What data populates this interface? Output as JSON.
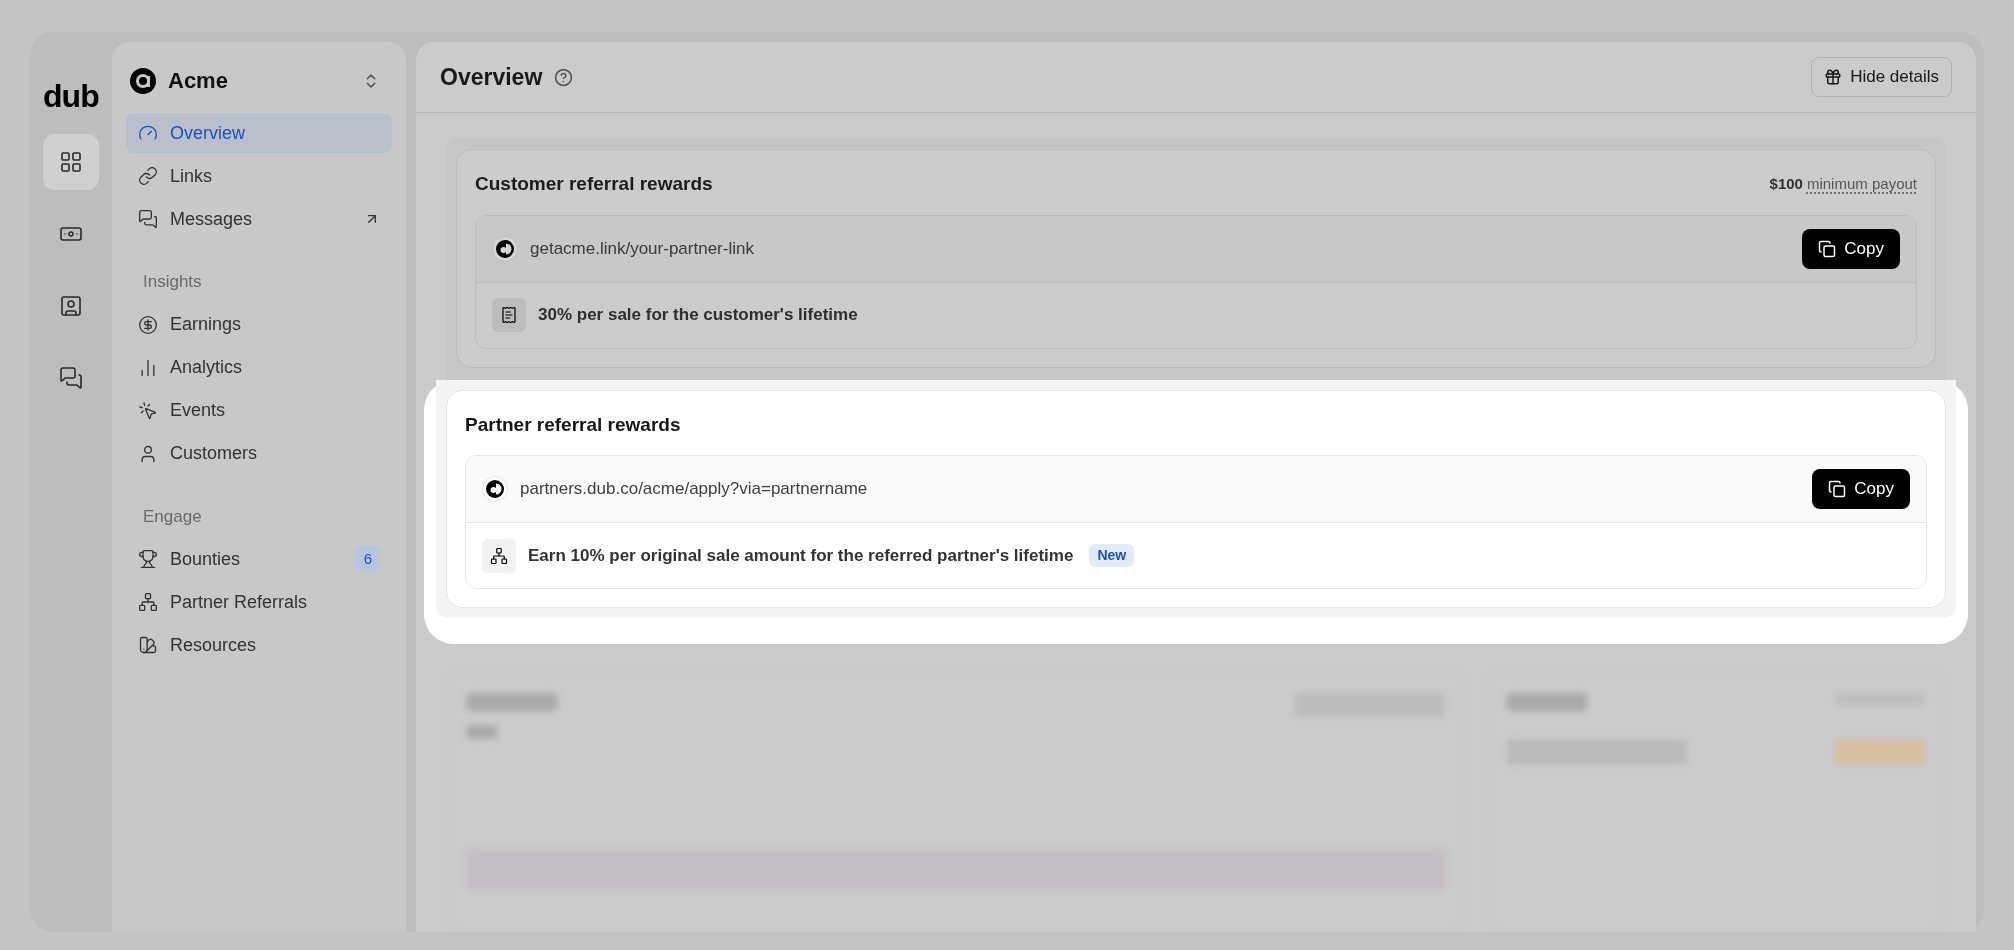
{
  "rail": {
    "logo": "dub",
    "items": [
      {
        "selected": true
      },
      {
        "selected": false
      },
      {
        "selected": false
      },
      {
        "selected": false
      }
    ]
  },
  "workspace": {
    "name": "Acme"
  },
  "nav": [
    {
      "label": "Overview",
      "selected": true,
      "external": false
    },
    {
      "label": "Links",
      "selected": false,
      "external": false
    },
    {
      "label": "Messages",
      "selected": false,
      "external": true
    }
  ],
  "sections": [
    {
      "heading": "Insights",
      "items": [
        {
          "label": "Earnings",
          "selected": false
        },
        {
          "label": "Analytics",
          "selected": false
        },
        {
          "label": "Events",
          "selected": false
        },
        {
          "label": "Customers",
          "selected": false
        }
      ]
    },
    {
      "heading": "Engage",
      "items": [
        {
          "label": "Bounties",
          "selected": false,
          "badge": "6"
        },
        {
          "label": "Partner Referrals",
          "selected": false
        },
        {
          "label": "Resources",
          "selected": false
        }
      ]
    }
  ],
  "page": {
    "title": "Overview",
    "hide_details_button": "Hide details"
  },
  "reward_cards": [
    {
      "title": "Customer referral rewards",
      "payout_amount": "$100",
      "payout_label": "minimum payout",
      "link": "getacme.link/your-partner-link",
      "copy_button": "Copy",
      "reward": "30% per sale for the customer's lifetime",
      "highlighted": false
    },
    {
      "title": "Partner referral rewards",
      "link": "partners.dub.co/acme/apply?via=partnername",
      "copy_button": "Copy",
      "reward": "Earn 10% per original sale amount for the referred partner's lifetime",
      "badge": "New",
      "highlighted": true
    }
  ]
}
